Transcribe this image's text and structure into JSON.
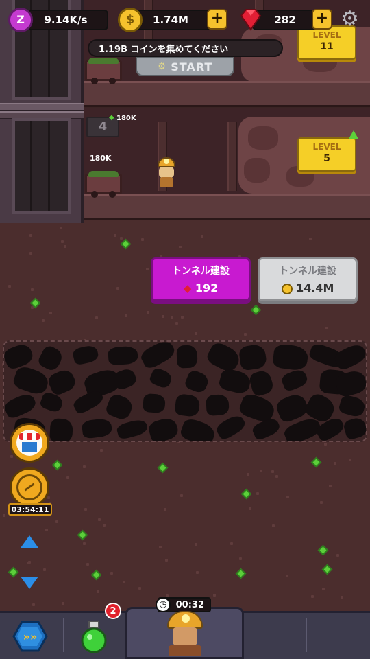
{
  "hud": {
    "idle_rate": "9.14K/s",
    "coins": "1.74M",
    "gems": "282",
    "coins_plus_label": "+",
    "gems_plus_label": "+"
  },
  "colors": {
    "gem_build_button": "#c81ad0",
    "coin_build_button": "#d9dadc",
    "level_button": "#f5cf27",
    "accent_green": "#5ccf3a"
  },
  "mine_shaft_top": {
    "goal_text": "1.19B コインを集めてください",
    "start_label": "START",
    "level_button_label": "LEVEL",
    "level_value": "11"
  },
  "mine_shaft_4": {
    "shaft_number": "4",
    "cart_amount": "180K",
    "shaft_bonus": "180K",
    "level_button_label": "LEVEL",
    "level_value": "5"
  },
  "build_tunnel": {
    "gem_option": {
      "label": "トンネル建設",
      "cost": "192",
      "icon": "ruby-icon"
    },
    "coin_option": {
      "label": "トンネル建設",
      "cost": "14.4M",
      "icon": "coin-icon"
    }
  },
  "side_buttons": {
    "shop_icon": "shop-icon",
    "boost_icon": "speedometer-icon",
    "boost_timer": "03:54:11",
    "scroll_up_icon": "triangle-up-icon",
    "scroll_down_icon": "triangle-down-icon"
  },
  "bottom_bar": {
    "boost_timer": "00:32",
    "potion_badge": "2",
    "manager_icon": "miner-manager-icon",
    "hex_icon": "chevrons-hex-icon",
    "potion_icon": "green-potion-icon"
  }
}
